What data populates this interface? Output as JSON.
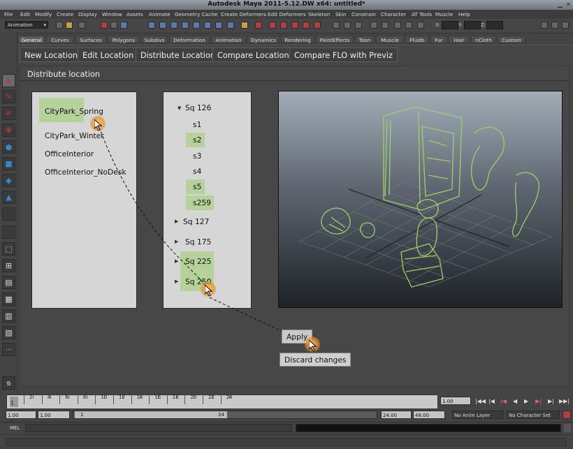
{
  "window": {
    "title": "Autodesk Maya 2011-5.12.DW x64: untitled*"
  },
  "menubar": [
    "File",
    "Edit",
    "Modify",
    "Create",
    "Display",
    "Window",
    "Assets",
    "Animate",
    "Geometry Cache",
    "Create Deformers",
    "Edit Deformers",
    "Skeleton",
    "Skin",
    "Constrain",
    "Character",
    "AT Tools",
    "Muscle",
    "Help"
  ],
  "statusline": {
    "mode": "Animation",
    "x_label": "X:",
    "y_label": "Y:",
    "z_label": "Z:"
  },
  "shelf_tabs": [
    "General",
    "Curves",
    "Surfaces",
    "Polygons",
    "Subdivs",
    "Deformation",
    "Animation",
    "Dynamics",
    "Rendering",
    "PaintEffects",
    "Toon",
    "Muscle",
    "Fluids",
    "Fur",
    "Hair",
    "nCloth",
    "Custom"
  ],
  "shelf_buttons": [
    "New Location",
    "Edit Location",
    "Distribute Location",
    "Compare Locations",
    "Compare FLO with Previz"
  ],
  "panel": {
    "title": "Distribute location"
  },
  "locations": [
    "CityPark_Spring",
    "CityPark_Winter",
    "OfficeInterior",
    "OfficeInterior_NoDesk"
  ],
  "sequences": {
    "sq126": "Sq 126",
    "shots": [
      "s1",
      "s2",
      "s3",
      "s4",
      "s5",
      "s259"
    ],
    "others": [
      "Sq 127",
      "Sq 175",
      "Sq 225",
      "Sq 250"
    ]
  },
  "buttons": {
    "apply": "Apply",
    "discard": "Discard changes"
  },
  "timeline": {
    "ticks": [
      "2",
      "4",
      "6",
      "8",
      "10",
      "12",
      "14",
      "16",
      "18",
      "20",
      "22",
      "24"
    ],
    "current_frame": "1",
    "current_field": "1.00"
  },
  "range": {
    "start": "1.00",
    "playback_start": "1.00",
    "slider_start": "1",
    "slider_end": "24",
    "playback_end": "24.00",
    "end": "48.00",
    "anim_layer": "No Anim Layer",
    "character_set": "No Character Set"
  },
  "cmdline": {
    "label": "MEL"
  },
  "colors": {
    "selection": "#b6d19a",
    "panel_bg": "#d6d6d6",
    "cursor_glow": "#f0a030",
    "sketch": "#9fcf6a"
  }
}
